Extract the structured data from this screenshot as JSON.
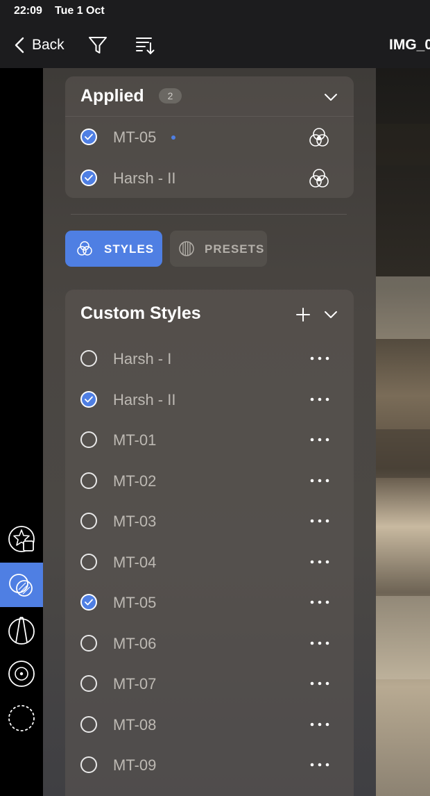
{
  "status_bar": {
    "time": "22:09",
    "date": "Tue 1 Oct"
  },
  "nav": {
    "back_label": "Back",
    "filter_icon": "filter-icon",
    "sort_icon": "sort-icon",
    "title": "IMG_0"
  },
  "tool_rail": {
    "tools": [
      {
        "icon": "star-layers-icon",
        "active": false
      },
      {
        "icon": "styles-overlap-icon",
        "active": true
      },
      {
        "icon": "perspective-icon",
        "active": false
      },
      {
        "icon": "lens-icon",
        "active": false
      },
      {
        "icon": "dotted-circle-icon",
        "active": false
      }
    ]
  },
  "applied": {
    "title": "Applied",
    "count": "2",
    "items": [
      {
        "label": "MT-05",
        "checked": true,
        "modified_dot": true
      },
      {
        "label": "Harsh - II",
        "checked": true,
        "modified_dot": false
      }
    ]
  },
  "tabs": {
    "styles_label": "STYLES",
    "presets_label": "PRESETS",
    "selected": "styles"
  },
  "custom_styles": {
    "title": "Custom Styles",
    "items": [
      {
        "label": "Harsh - I",
        "checked": false
      },
      {
        "label": "Harsh - II",
        "checked": true
      },
      {
        "label": "MT-01",
        "checked": false
      },
      {
        "label": "MT-02",
        "checked": false
      },
      {
        "label": "MT-03",
        "checked": false
      },
      {
        "label": "MT-04",
        "checked": false
      },
      {
        "label": "MT-05",
        "checked": true
      },
      {
        "label": "MT-06",
        "checked": false
      },
      {
        "label": "MT-07",
        "checked": false
      },
      {
        "label": "MT-08",
        "checked": false
      },
      {
        "label": "MT-09",
        "checked": false
      }
    ]
  },
  "colors": {
    "accent": "#4f7fe3",
    "panel": "#47433f",
    "text_muted": "#bdb9b3"
  }
}
